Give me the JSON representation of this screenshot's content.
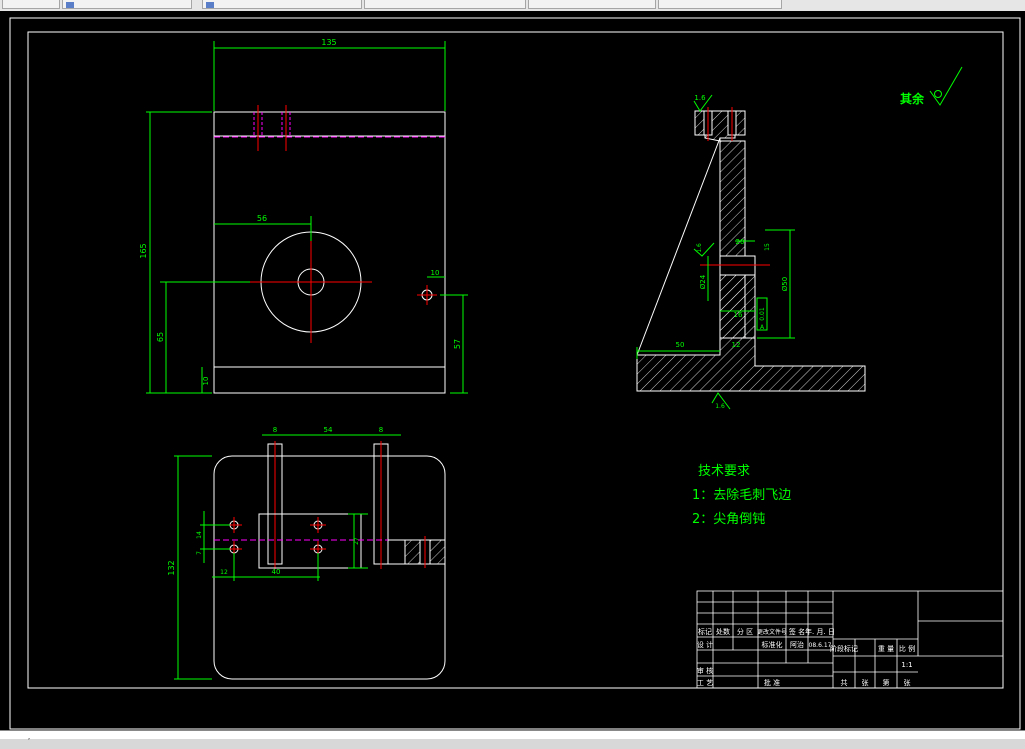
{
  "tabs": [
    {
      "label": ""
    },
    {
      "label": "",
      "has_icon": true
    },
    {
      "label": "",
      "has_icon": true
    },
    {
      "label": ""
    },
    {
      "label": ""
    },
    {
      "label": ""
    }
  ],
  "status": {
    "text": "ﾞ"
  },
  "dims": {
    "front_width": "135",
    "front_height": "165",
    "hole_center_x": "56",
    "hole_center_y": "65",
    "side_hole_offset": "10",
    "side_hole_height": "57",
    "base_thickness": "10"
  },
  "plan_dims": {
    "left_width": "8",
    "middle": "54",
    "right_width": "8",
    "depth": "132",
    "hole_y1": "14",
    "hole_y2": "7",
    "hole_x_offset": "12",
    "hole_spacing": "40",
    "slot": "27"
  },
  "section_dims": {
    "roughness_top": "1.6",
    "roughness_mid": "1.6",
    "roughness_bottom": "1.6",
    "bore_dia": "Ø24",
    "bore_width": "20",
    "bore_height": "15",
    "flange_height": "Ø50",
    "web_width": "16",
    "perpendicularity": "0.01",
    "datum": "A",
    "base_length": "50",
    "foot": "12"
  },
  "surface_note": {
    "label": "其余"
  },
  "tech_requirements": {
    "title": "技术要求",
    "items": [
      "1：去除毛刺飞边",
      "2：尖角倒钝"
    ]
  },
  "title_block": {
    "row_header": [
      "标记",
      "处数",
      "分 区",
      "更改文件号",
      "签 名",
      "年. 月. 日"
    ],
    "design": "设 计",
    "standardize": "标准化",
    "signer": "阿治",
    "date": "08.6.17",
    "stage_header": [
      "阶段标记",
      "重 量",
      "比 例"
    ],
    "scale": "1:1",
    "review": "审 核",
    "process": "工 艺",
    "approve": "批 准",
    "sheet_footer": [
      "共",
      "张",
      "第",
      "张"
    ]
  },
  "colors": {
    "line": "#ffffff",
    "dim": "#00ff00",
    "center": "#ff0000",
    "hidden": "#ff00ff",
    "text": "#00ff00"
  }
}
